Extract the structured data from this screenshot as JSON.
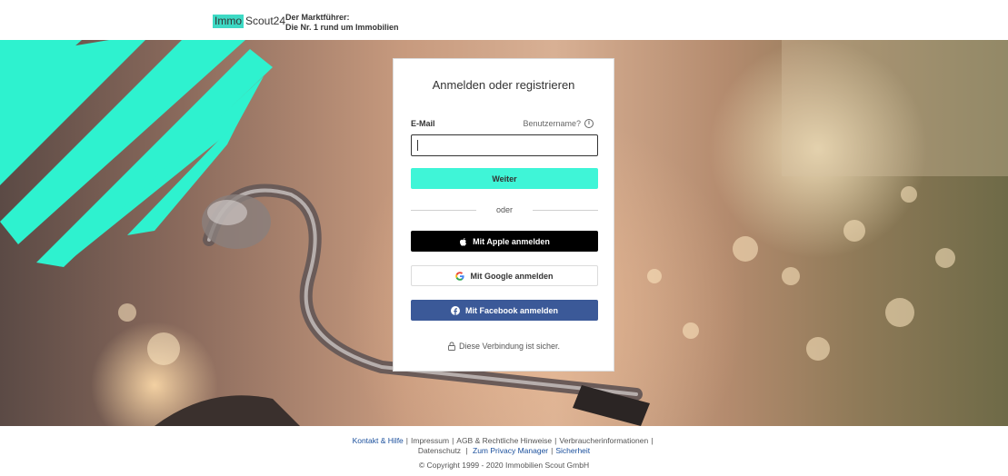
{
  "header": {
    "logo_immo": "Immo",
    "logo_scout": "Scout24",
    "tagline_line1": "Der Marktführer:",
    "tagline_line2": "Die Nr. 1 rund um Immobilien"
  },
  "login": {
    "title": "Anmelden oder registrieren",
    "email_label": "E-Mail",
    "username_link": "Benutzername?",
    "email_value": "",
    "continue_button": "Weiter",
    "divider_text": "oder",
    "apple_button": "Mit Apple anmelden",
    "google_button": "Mit Google anmelden",
    "facebook_button": "Mit Facebook anmelden",
    "secure_text": "Diese Verbindung ist sicher."
  },
  "footer": {
    "links_row1": [
      "Kontakt & Hilfe",
      "Impressum",
      "AGB & Rechtliche Hinweise",
      "Verbraucherinformationen"
    ],
    "links_row2": [
      "Datenschutz",
      "Zum Privacy Manager",
      "Sicherheit"
    ],
    "copyright": "© Copyright 1999 - 2020 Immobilien Scout GmbH"
  },
  "colors": {
    "accent": "#3ff5d7",
    "facebook": "#3b5998",
    "apple": "#000000",
    "link_blue": "#1a4f9c"
  },
  "icons": [
    "info-icon",
    "apple-icon",
    "google-icon",
    "facebook-icon",
    "lock-icon"
  ]
}
